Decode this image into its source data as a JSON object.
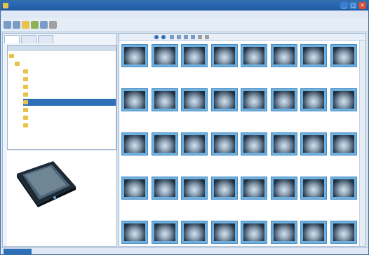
{
  "window": {
    "title": ""
  },
  "menu": {
    "items": [
      "",
      "",
      "",
      ""
    ]
  },
  "left_panel": {
    "tabs": [
      "",
      "",
      ""
    ],
    "tree": {
      "path": "",
      "nodes": [
        "",
        "",
        "",
        "",
        "",
        "",
        "",
        "",
        "",
        ""
      ],
      "selected_index": 6
    }
  },
  "grid": {
    "captions": [
      "",
      "",
      "",
      "",
      "",
      "",
      "",
      "",
      "",
      "",
      "",
      "",
      "",
      "",
      "",
      "",
      "",
      "",
      "",
      "",
      "",
      "",
      "",
      "",
      "",
      "",
      "",
      "",
      "",
      "",
      "",
      "",
      "",
      "",
      "",
      "",
      "",
      "",
      "",
      ""
    ]
  },
  "status": {
    "left": ""
  },
  "colors": {
    "accent": "#2f6fb8",
    "thumb_frame": "#6db0df"
  },
  "icons": {
    "toolbar": [
      "back-icon",
      "forward-icon",
      "up-icon",
      "refresh-icon",
      "scan-icon",
      "settings-icon"
    ],
    "grid_toolbar": [
      "prev-icon",
      "next-icon",
      "up-icon",
      "view-icon",
      "sort-icon",
      "filter-icon",
      "print-icon",
      "delete-icon"
    ]
  }
}
